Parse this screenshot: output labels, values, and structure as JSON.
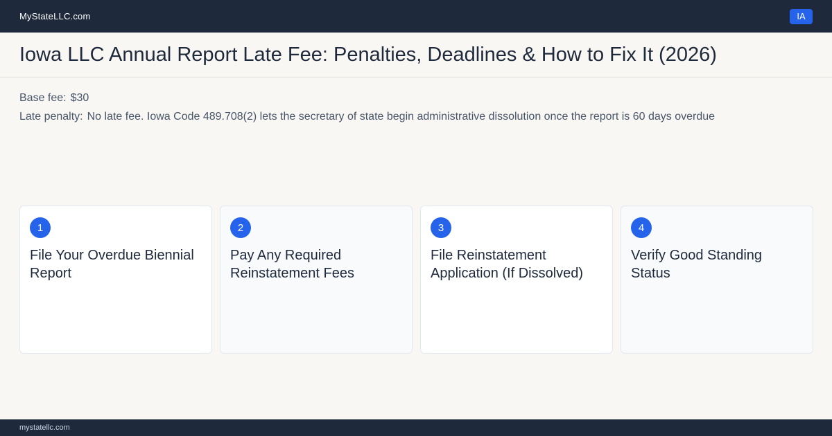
{
  "header": {
    "brand": "MyStateLLC.com",
    "state_badge": "IA"
  },
  "page_title": "Iowa LLC Annual Report Late Fee: Penalties, Deadlines & How to Fix It (2026)",
  "facts": {
    "base_fee_label": "Base fee:",
    "base_fee_value": "$30",
    "late_penalty_label": "Late penalty:",
    "late_penalty_value": "No late fee. Iowa Code 489.708(2) lets the secretary of state begin administrative dissolution once the report is 60 days overdue"
  },
  "steps": [
    {
      "number": "1",
      "title": "File Your Overdue Biennial Report"
    },
    {
      "number": "2",
      "title": "Pay Any Required Reinstatement Fees"
    },
    {
      "number": "3",
      "title": "File Reinstatement Application (If Dissolved)"
    },
    {
      "number": "4",
      "title": "Verify Good Standing Status"
    }
  ],
  "footer": {
    "domain": "mystatellc.com"
  },
  "colors": {
    "navy": "#1e293b",
    "accent": "#2563eb",
    "page_bg": "#f9f7f3"
  }
}
